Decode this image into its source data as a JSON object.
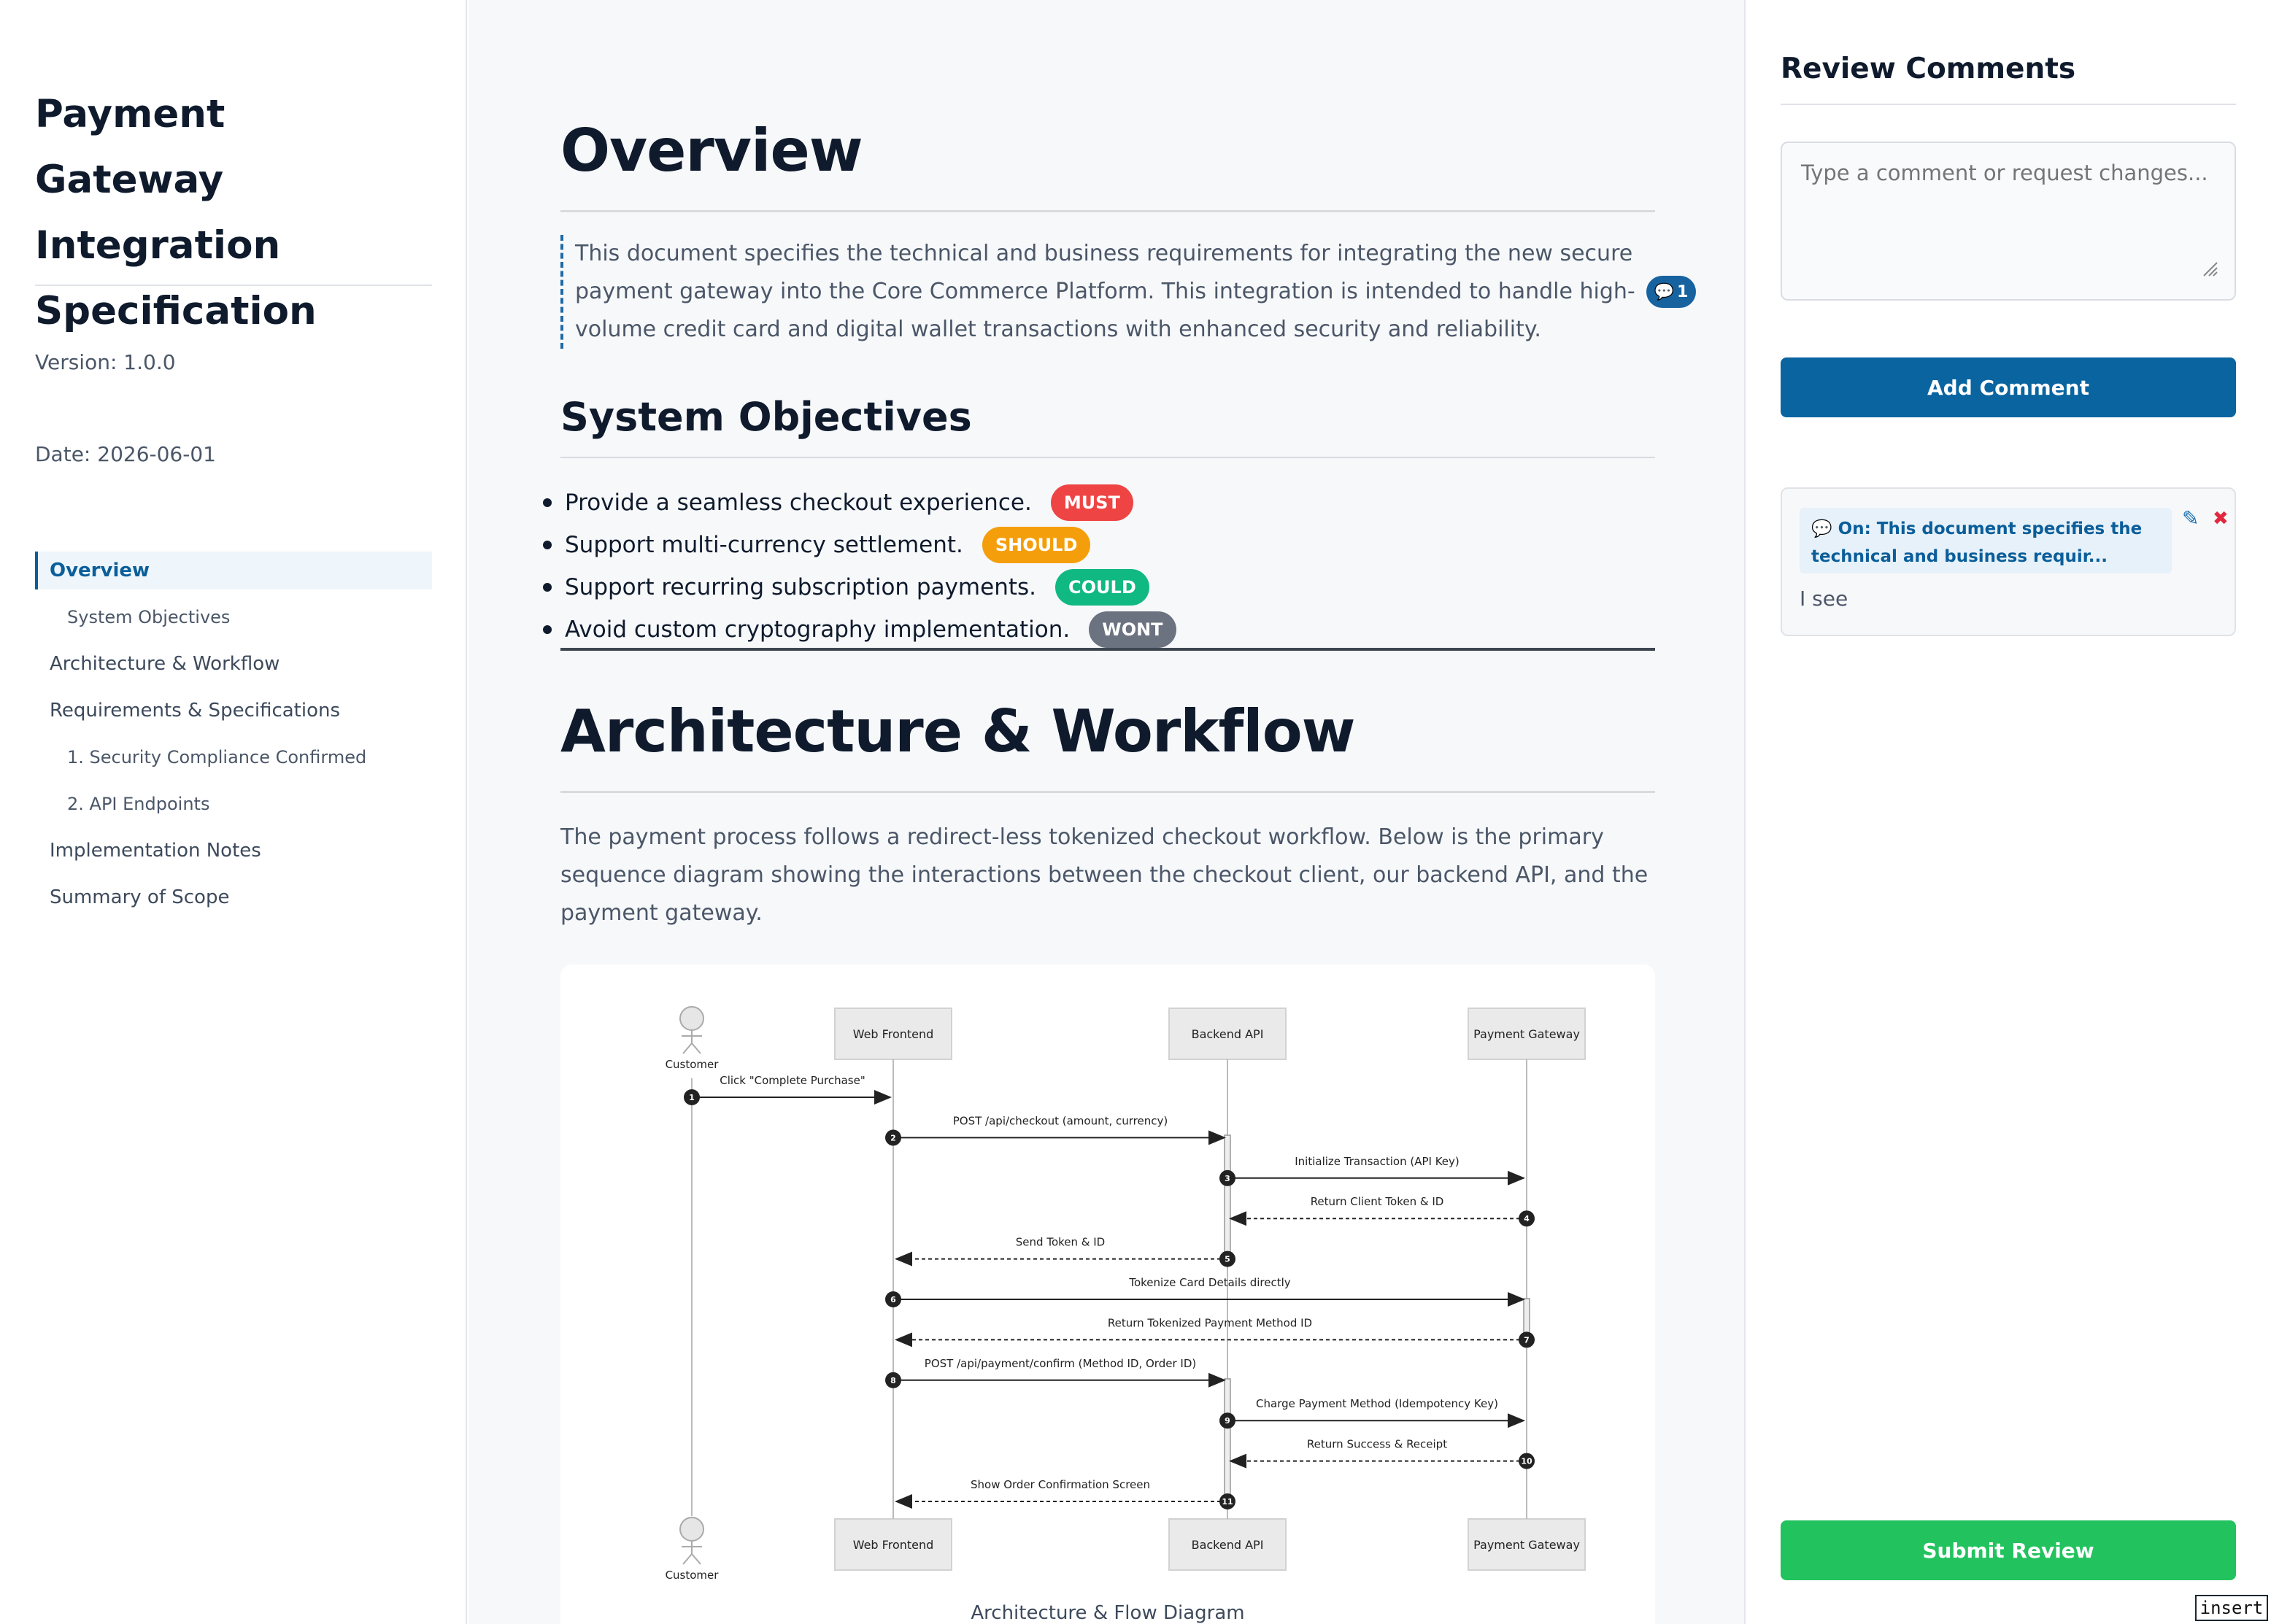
{
  "sidebar": {
    "title": "Payment Gateway Integration Specification",
    "version": "Version: 1.0.0",
    "date": "Date: 2026-06-01",
    "toc": [
      {
        "label": "Overview",
        "level": 1,
        "active": true
      },
      {
        "label": "System Objectives",
        "level": 2
      },
      {
        "label": "Architecture & Workflow",
        "level": 1
      },
      {
        "label": "Requirements & Specifications",
        "level": 1
      },
      {
        "label": "1. Security Compliance Confirmed",
        "level": 2
      },
      {
        "label": "2. API Endpoints",
        "level": 2
      },
      {
        "label": "Implementation Notes",
        "level": 1
      },
      {
        "label": "Summary of Scope",
        "level": 1
      }
    ]
  },
  "main": {
    "overview_heading": "Overview",
    "overview_text": "This document specifies the technical and business requirements for integrating the new secure payment gateway into the Core Commerce Platform. This integration is intended to handle high-volume credit card and digital wallet transactions with enhanced security and reliability.",
    "overview_comment_count": "1",
    "objectives_heading": "System Objectives",
    "objectives": [
      {
        "text": "Provide a seamless checkout experience.",
        "tag": "MUST",
        "color": "#ef4444"
      },
      {
        "text": "Support multi-currency settlement.",
        "tag": "SHOULD",
        "color": "#f59e0b"
      },
      {
        "text": "Support recurring subscription payments.",
        "tag": "COULD",
        "color": "#10b981"
      },
      {
        "text": "Avoid custom cryptography implementation.",
        "tag": "WONT",
        "color": "#6b7280"
      }
    ],
    "architecture_heading": "Architecture & Workflow",
    "architecture_text": "The payment process follows a redirect-less tokenized checkout workflow. Below is the primary sequence diagram showing the interactions between the checkout client, our backend API, and the payment gateway.",
    "diagram": {
      "actors": [
        "Customer",
        "Web Frontend",
        "Backend API",
        "Payment Gateway"
      ],
      "messages": [
        {
          "n": "1",
          "from": 0,
          "to": 1,
          "label": "Click \"Complete Purchase\"",
          "dashed": false
        },
        {
          "n": "2",
          "from": 1,
          "to": 2,
          "label": "POST /api/checkout (amount, currency)",
          "dashed": false
        },
        {
          "n": "3",
          "from": 2,
          "to": 3,
          "label": "Initialize Transaction (API Key)",
          "dashed": false
        },
        {
          "n": "4",
          "from": 3,
          "to": 2,
          "label": "Return Client Token & ID",
          "dashed": true
        },
        {
          "n": "5",
          "from": 2,
          "to": 1,
          "label": "Send Token & ID",
          "dashed": true
        },
        {
          "n": "6",
          "from": 1,
          "to": 3,
          "label": "Tokenize Card Details directly",
          "dashed": false
        },
        {
          "n": "7",
          "from": 3,
          "to": 1,
          "label": "Return Tokenized Payment Method ID",
          "dashed": true
        },
        {
          "n": "8",
          "from": 1,
          "to": 2,
          "label": "POST /api/payment/confirm (Method ID, Order ID)",
          "dashed": false
        },
        {
          "n": "9",
          "from": 2,
          "to": 3,
          "label": "Charge Payment Method (Idempotency Key)",
          "dashed": false
        },
        {
          "n": "10",
          "from": 3,
          "to": 2,
          "label": "Return Success & Receipt",
          "dashed": true
        },
        {
          "n": "11",
          "from": 2,
          "to": 1,
          "label": "Show Order Confirmation Screen",
          "dashed": true
        }
      ],
      "caption": "Architecture & Flow Diagram"
    }
  },
  "review": {
    "title": "Review Comments",
    "placeholder": "Type a comment or request changes...",
    "add_label": "Add Comment",
    "comment_quote": "💬 On: This document specifies the technical and business requir...",
    "comment_text": "I see",
    "submit_label": "Submit Review",
    "mode_label": "insert"
  },
  "colors": {
    "primary": "#0a64a0",
    "submit": "#22c35e",
    "delete": "#e0283e"
  }
}
